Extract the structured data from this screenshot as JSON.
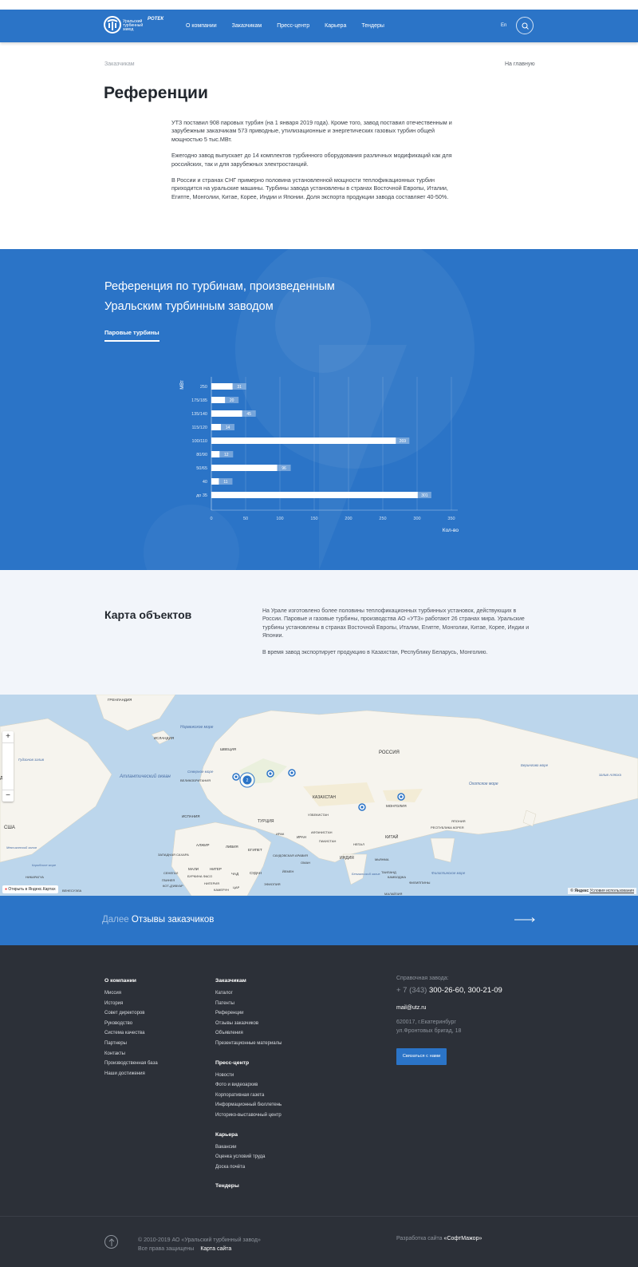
{
  "header": {
    "logo_text": "Уральский турбинный завод",
    "logo_partner": "РОТЕК",
    "nav": [
      "О компании",
      "Заказчикам",
      "Пресс-центр",
      "Карьера",
      "Тендеры"
    ],
    "lang": "En",
    "colors": {
      "primary": "#2b74c7"
    }
  },
  "breadcrumb": "Заказчикам",
  "home_link": "На главную",
  "page_title": "Референции",
  "intro": [
    "УТЗ поставил 908 паровых турбин (на 1 января 2019 года). Кроме того, завод поставил отечественным и зарубежным заказчикам 573 приводные, утилизационные и энергетических газовых турбин общей мощностью 5 тыс.МВт.",
    "Ежегодно завод выпускает до 14 комплектов турбинного оборудования различных модификаций как для российских, так и для зарубежных электростанций.",
    "В России и странах СНГ примерно половина установленной мощности теплофикационных турбин приходится на уральские машины. Турбины завода установлены в странах Восточной Европы, Италии, Египте, Монголии, Китае, Корее, Индии и Японии. Доля экспорта продукции завода составляет 40-50%."
  ],
  "reference": {
    "title": "Референция по турбинам, произведенным Уральским турбинным заводом",
    "tab": "Паровые турбины"
  },
  "chart_data": {
    "type": "bar",
    "orientation": "horizontal",
    "categories": [
      "250",
      "175/185",
      "135/140",
      "115/120",
      "100/110",
      "80/90",
      "50/65",
      "40",
      "до 35"
    ],
    "values": [
      31,
      20,
      45,
      14,
      269,
      12,
      96,
      11,
      301
    ],
    "xlabel": "Кол-во",
    "ylabel": "МВт",
    "xlim": [
      0,
      350
    ],
    "xticks": [
      0,
      50,
      100,
      150,
      200,
      250,
      300,
      350
    ],
    "grid": true
  },
  "map_section": {
    "title": "Карта объектов",
    "text": [
      "На Урале изготовлено более половины теплофикационных турбинных установок, действующих в России. Паровые и газовые турбины, производства АО «УТЗ» работают 26 странах мира. Уральские турбины установлены в странах Восточной Европы, Италии, Египте, Монголии, Китае, Корее, Индии и Японии.",
      "В время завод экспортирует продукцию в Казахстан, Республику Беларусь, Монголию."
    ],
    "map_labels": {
      "greenland": "ГРЕНЛАНДИЯ",
      "norwegian_sea": "Норвежское море",
      "iceland": "ИСЛАНДИЯ",
      "sweden": "ШВЕЦИЯ",
      "hudson": "Гудзонов залив",
      "atlantic": "Атлантический океан",
      "north_sea": "Северное море",
      "uk": "ВЕЛИКОБРИТАНИЯ",
      "russia": "РОССИЯ",
      "bering": "Берингово море",
      "okhotsk": "Охотское море",
      "alaska": "залив Аляска",
      "kazakhstan": "КАЗАХСТАН",
      "mongolia": "МОНГОЛИЯ",
      "usa": "США",
      "spain": "ИСПАНИЯ",
      "turkey": "ТУРЦИЯ",
      "uzbekistan": "УЗБЕКИСТАН",
      "china": "КИТАЙ",
      "japan": "ЯПОНИЯ",
      "korea": "РЕСПУБЛИКА КОРЕЯ",
      "algeria": "АЛЖИР",
      "libya": "ЛИВИЯ",
      "egypt": "ЕГИПЕТ",
      "iraq": "ИРАК",
      "iran": "ИРАН",
      "afghanistan": "АФГАНИСТАН",
      "pakistan": "ПАКИСТАН",
      "nepal": "НЕПАЛ",
      "india": "ИНДИЯ",
      "saudi": "САУДОВСКАЯ АРАВИЯ",
      "western_sahara": "ЗАПАДНАЯ САХАРА",
      "mali": "МАЛИ",
      "niger": "НИГЕР",
      "chad": "ЧАД",
      "sudan": "СУДАН",
      "mexico_gulf": "Мексиканский залив",
      "caribbean": "Карибское море",
      "nicaragua": "НИКАРАГУА",
      "venezuela": "ВЕНЕСУЭЛА",
      "senegal": "СЕНЕГАЛ",
      "guinea": "ГВИНЕЯ",
      "burkina": "БУРКИНА ФАСО",
      "ivory": "КОТ-Д'ИВУАР",
      "nigeria": "НИГЕРИЯ",
      "cameroon": "КАМЕРУН",
      "car": "ЦАР",
      "ethiopia": "ЭФИОПИЯ",
      "yemen": "ЙЕМЕН",
      "oman": "ОМАН",
      "bengal": "Бенгальский залив",
      "myanmar": "МЬЯНМА",
      "thailand": "ТАИЛАНД",
      "cambodia": "КАМБОДЖА",
      "philippine_sea": "Филиппинское море",
      "philippines": "ФИЛИППИНЫ",
      "malaysia": "МАЛАЙЗИЯ",
      "d_label": "Д"
    },
    "cluster_count": "2",
    "zoom_in": "+",
    "zoom_out": "−",
    "open_in_yandex": "Открыть в Яндекс.Картах",
    "copyright_yandex": "© Яндекс",
    "terms": "Условия использования"
  },
  "next": {
    "prefix": "Далее",
    "title": "Отзывы заказчиков"
  },
  "footer": {
    "col1": {
      "title": "О компании",
      "links": [
        "Миссия",
        "История",
        "Совет директоров",
        "Руководство",
        "Система качества",
        "Партнеры",
        "Контакты",
        "Производственная база",
        "Наши достижения"
      ]
    },
    "col2": {
      "title": "Заказчикам",
      "links": [
        "Каталог",
        "Патенты",
        "Референции",
        "Отзывы заказчиков",
        "Объявления",
        "Презентационные материалы"
      ],
      "press_title": "Пресс-центр",
      "press_links": [
        "Новости",
        "Фото и видеоархив",
        "Корпоративная газета",
        "Информационный бюллетень",
        "Историко-выставочный центр"
      ],
      "career_title": "Карьера",
      "career_links": [
        "Вакансии",
        "Оценка условий труда",
        "Доска почёта"
      ],
      "tenders_title": "Тендеры"
    },
    "contact_label": "Справочная завода:",
    "phone_code": "+ 7 (343)",
    "phone_numbers": "300-26-60, 300-21-09",
    "email": "mail@utz.ru",
    "address_line1": "620017, г.Екатеринбург",
    "address_line2": "ул.Фронтовых бригад, 18",
    "contact_button": "Связаться с нами",
    "copyright": "© 2010-2019 АО «Уральский турбинный завод»",
    "rights": "Все права защищены",
    "sitemap": "Карта сайта",
    "dev_label": "Разработка сайта",
    "dev_name": "«СофтМажор»"
  }
}
